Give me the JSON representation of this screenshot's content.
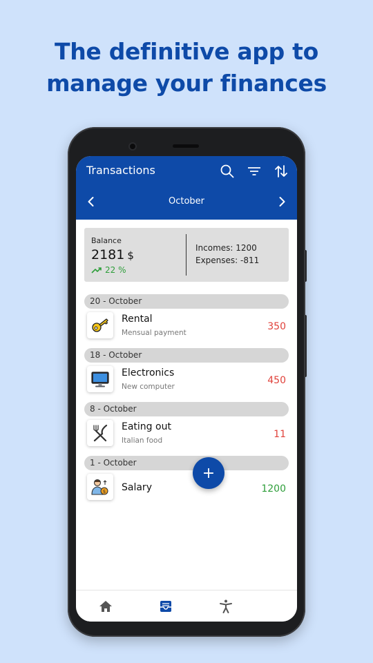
{
  "headline": {
    "line1": "The definitive app to",
    "line2": "manage your finances"
  },
  "app": {
    "title": "Transactions",
    "icons": [
      "search-icon",
      "filter-icon",
      "sort-icon"
    ],
    "month": "October"
  },
  "balance": {
    "label": "Balance",
    "value": "2181",
    "currency": "$",
    "trend": "22 %",
    "incomes": "Incomes: 1200",
    "expenses": "Expenses: -811"
  },
  "groups": [
    {
      "date": "20 - October",
      "tx": {
        "name": "Rental",
        "desc": "Mensual payment",
        "amount": "350",
        "type": "expense",
        "icon": "key-icon"
      }
    },
    {
      "date": "18 - October",
      "tx": {
        "name": "Electronics",
        "desc": "New computer",
        "amount": "450",
        "type": "expense",
        "icon": "computer-icon"
      }
    },
    {
      "date": "8 - October",
      "tx": {
        "name": "Eating out",
        "desc": "Italian food",
        "amount": "11",
        "type": "expense",
        "icon": "cutlery-icon"
      }
    },
    {
      "date": "1 - October",
      "tx": {
        "name": "Salary",
        "desc": "",
        "amount": "1200",
        "type": "income",
        "icon": "salary-icon"
      }
    }
  ],
  "nav": [
    "home-icon",
    "inbox-icon",
    "accessibility-icon"
  ],
  "fab": "+",
  "colors": {
    "primary": "#0e4aa8",
    "background": "#cfe2fb",
    "expense": "#e0413a",
    "income": "#2e9e3a"
  }
}
